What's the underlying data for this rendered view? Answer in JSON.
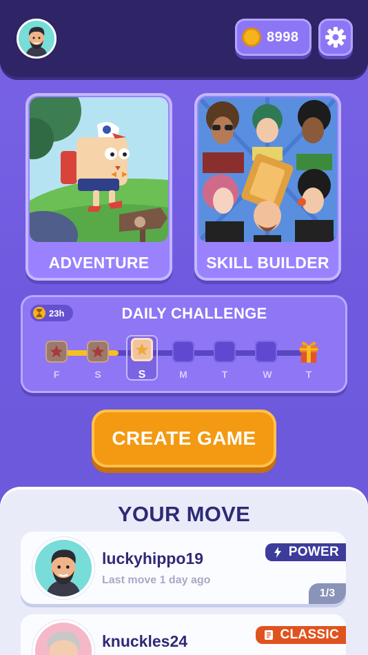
{
  "header": {
    "coins": "8998"
  },
  "modes": {
    "adventure_label": "ADVENTURE",
    "skill_builder_label": "SKILL BUILDER"
  },
  "daily": {
    "timer": "23h",
    "title": "DAILY CHALLENGE",
    "days": [
      "F",
      "S",
      "S",
      "M",
      "T",
      "W",
      "T"
    ],
    "completed_days": 2,
    "current_day_index": 2
  },
  "create_game_label": "CREATE GAME",
  "your_move": {
    "title": "YOUR MOVE",
    "games": [
      {
        "username": "luckyhippo19",
        "last_move": "Last move 1 day ago",
        "mode": "POWER",
        "turn": "1/3"
      },
      {
        "username": "knuckles24",
        "mode": "CLASSIC"
      }
    ]
  },
  "colors": {
    "background": "#7a63e6",
    "header": "#2e2466",
    "accent_orange": "#f39a12",
    "coin_gold": "#f5b31c",
    "title_navy": "#2e2a77",
    "power_badge": "#3d3c9b",
    "classic_badge": "#e0531f"
  }
}
